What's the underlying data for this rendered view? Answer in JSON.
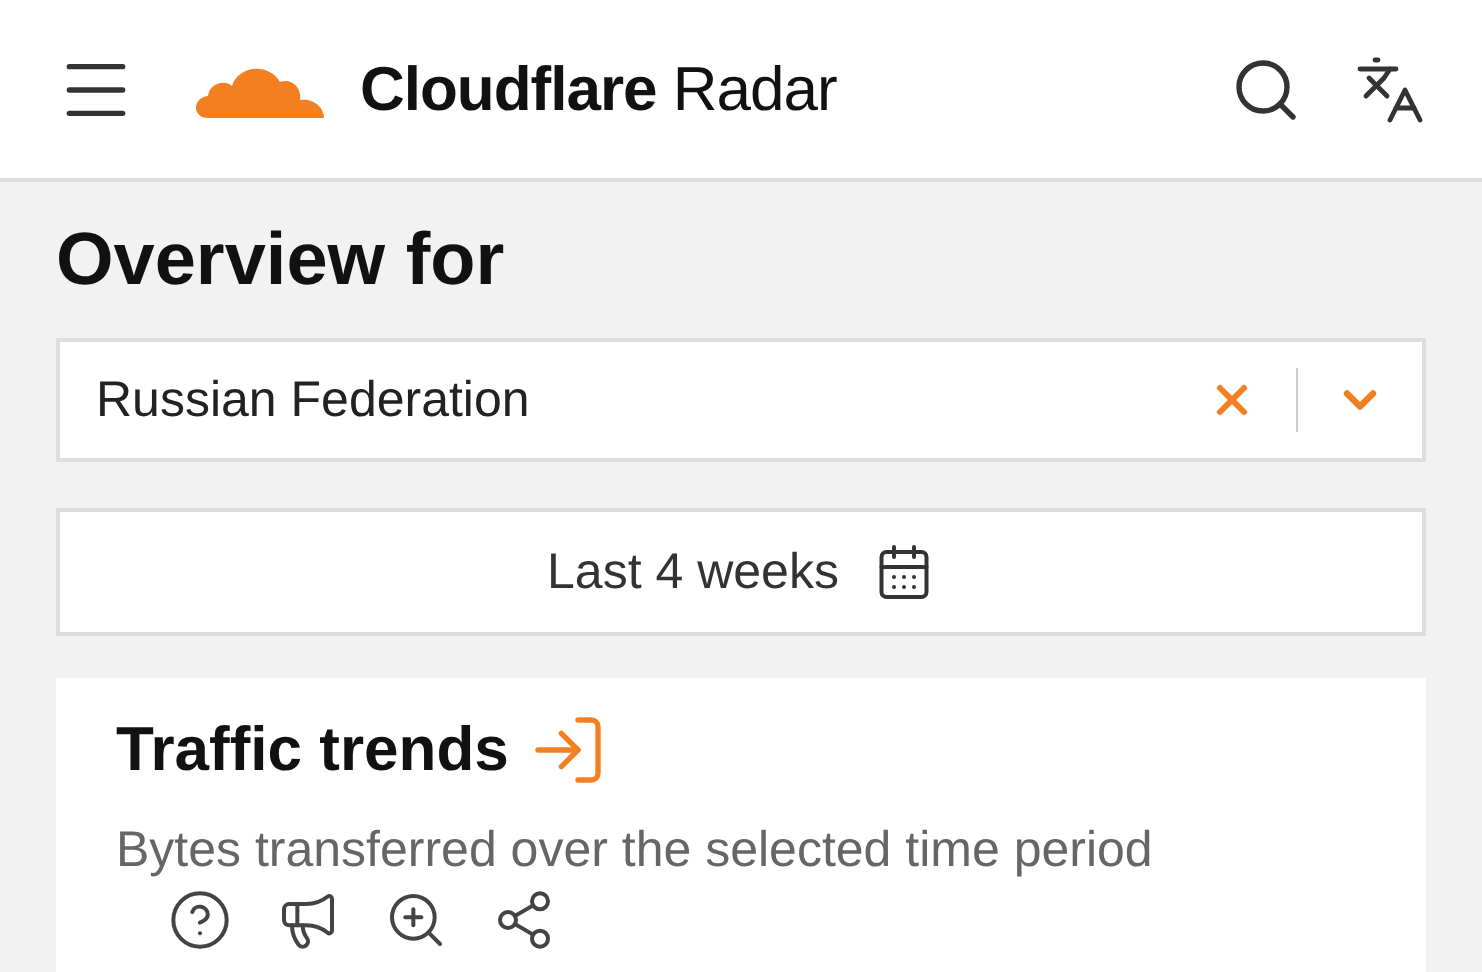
{
  "header": {
    "brand": "**Cloudflare** Radar"
  },
  "overview": {
    "heading": "Overview for",
    "location": {
      "value": "Russian Federation"
    },
    "date_range": "Last 4 weeks"
  },
  "card": {
    "title": "Traffic trends",
    "subtitle": "Bytes transferred over the selected time period"
  }
}
